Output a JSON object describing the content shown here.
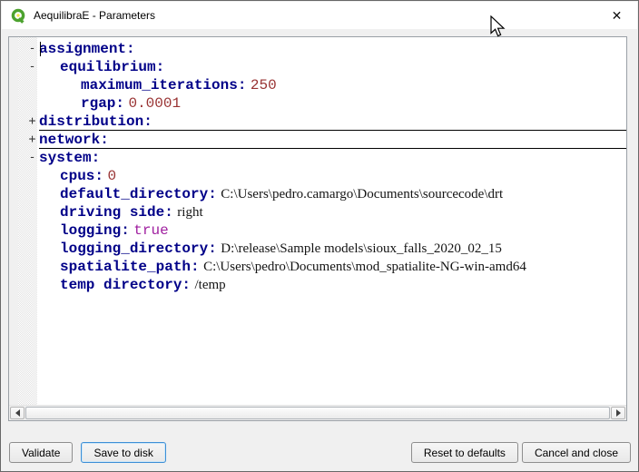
{
  "window": {
    "title": "AequilibraE - Parameters",
    "close_glyph": "✕"
  },
  "editor": {
    "fold_glyphs": {
      "expanded": "-",
      "collapsed": "+"
    },
    "lines": [
      {
        "fold": "expanded",
        "indent": 0,
        "key": "assignment:",
        "value": "",
        "style": "",
        "folded": false,
        "caret": true
      },
      {
        "fold": "expanded",
        "indent": 1,
        "key": "equilibrium:",
        "value": "",
        "style": "",
        "folded": false
      },
      {
        "fold": "",
        "indent": 2,
        "key": "maximum_iterations:",
        "value": "250",
        "style": "number",
        "folded": false
      },
      {
        "fold": "",
        "indent": 2,
        "key": "rgap:",
        "value": "0.0001",
        "style": "number",
        "folded": false
      },
      {
        "fold": "collapsed",
        "indent": 0,
        "key": "distribution:",
        "value": "",
        "style": "",
        "folded": true
      },
      {
        "fold": "collapsed",
        "indent": 0,
        "key": "network:",
        "value": "",
        "style": "",
        "folded": true
      },
      {
        "fold": "expanded",
        "indent": 0,
        "key": "system:",
        "value": "",
        "style": "",
        "folded": false
      },
      {
        "fold": "",
        "indent": 1,
        "key": "cpus:",
        "value": "0",
        "style": "number",
        "folded": false
      },
      {
        "fold": "",
        "indent": 1,
        "key": "default_directory:",
        "value": "C:\\Users\\pedro.camargo\\Documents\\sourcecode\\drt",
        "style": "text",
        "folded": false
      },
      {
        "fold": "",
        "indent": 1,
        "key": "driving side:",
        "value": "right",
        "style": "text",
        "folded": false
      },
      {
        "fold": "",
        "indent": 1,
        "key": "logging:",
        "value": "true",
        "style": "keyword",
        "folded": false
      },
      {
        "fold": "",
        "indent": 1,
        "key": "logging_directory:",
        "value": "D:\\release\\Sample models\\sioux_falls_2020_02_15",
        "style": "text",
        "folded": false
      },
      {
        "fold": "",
        "indent": 1,
        "key": "spatialite_path:",
        "value": "C:\\Users\\pedro\\Documents\\mod_spatialite-NG-win-amd64",
        "style": "text",
        "folded": false
      },
      {
        "fold": "",
        "indent": 1,
        "key": "temp directory:",
        "value": "/temp",
        "style": "text",
        "folded": false
      }
    ]
  },
  "footer": {
    "buttons_left": [
      {
        "label": "Validate"
      },
      {
        "label": "Save to disk",
        "focused": true
      }
    ],
    "buttons_right": [
      {
        "label": "Reset to defaults"
      },
      {
        "label": "Cancel and close"
      }
    ]
  },
  "colors": {
    "key": "#000088",
    "number": "#993333",
    "keyword": "#a020a0",
    "text_value": "#141414",
    "fold_line": "#000000",
    "focus_border": "#3d8fd6",
    "titlebar_bg": "#ffffff",
    "dialog_bg": "#f0f0f0",
    "brand_green": "#4ca22e",
    "brand_yellow": "#f2e84c"
  }
}
